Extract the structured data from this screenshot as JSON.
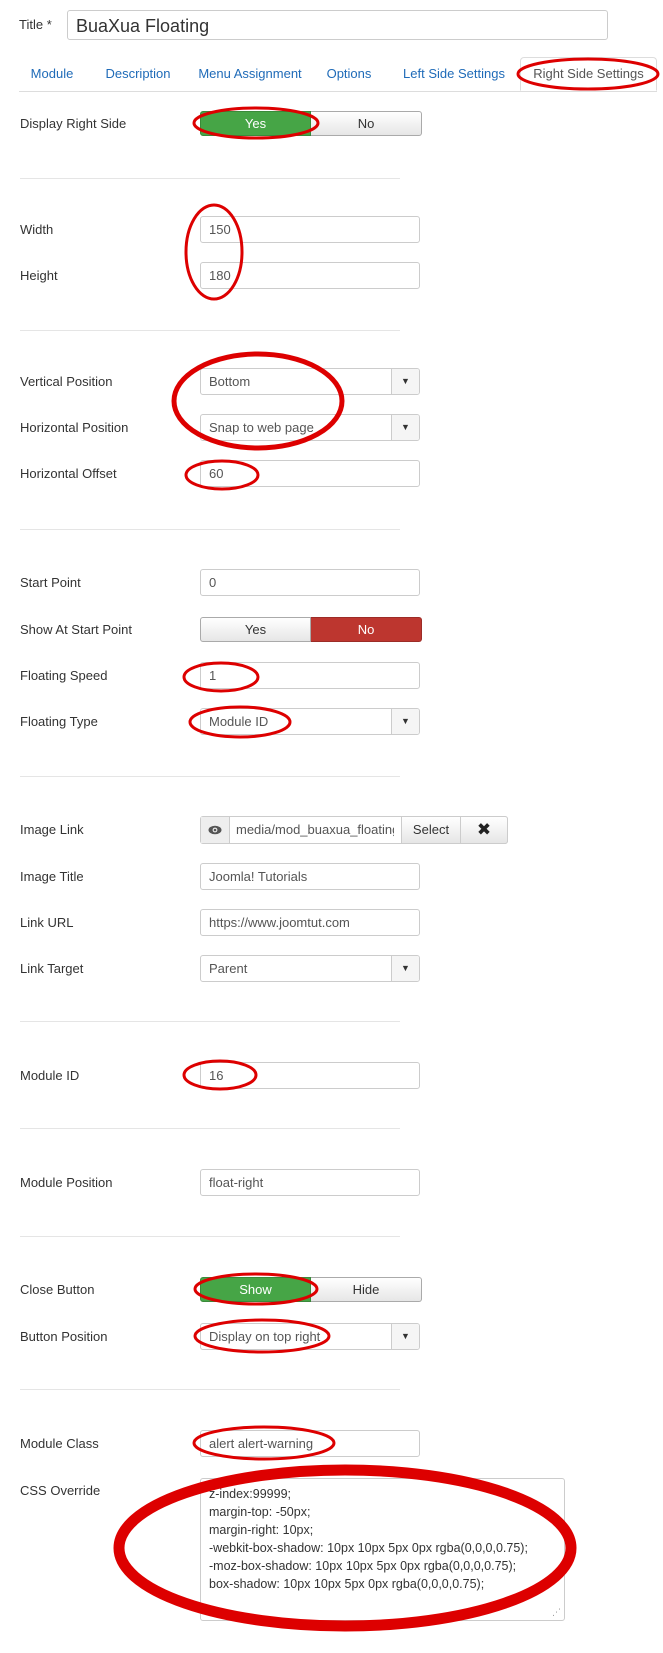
{
  "title": {
    "label": "Title *",
    "value": "BuaXua Floating"
  },
  "tabs": [
    "Module",
    "Description",
    "Menu Assignment",
    "Options",
    "Left Side Settings",
    "Right Side Settings"
  ],
  "display_right_side": {
    "label": "Display Right Side",
    "on": "Yes",
    "off": "No"
  },
  "width": {
    "label": "Width",
    "value": "150"
  },
  "height": {
    "label": "Height",
    "value": "180"
  },
  "vertical_position": {
    "label": "Vertical Position",
    "value": "Bottom"
  },
  "horizontal_position": {
    "label": "Horizontal Position",
    "value": "Snap to web page"
  },
  "horizontal_offset": {
    "label": "Horizontal Offset",
    "value": "60"
  },
  "start_point": {
    "label": "Start Point",
    "value": "0"
  },
  "show_at_start_point": {
    "label": "Show At Start Point",
    "on": "Yes",
    "off": "No"
  },
  "floating_speed": {
    "label": "Floating Speed",
    "value": "1"
  },
  "floating_type": {
    "label": "Floating Type",
    "value": "Module ID"
  },
  "image_link": {
    "label": "Image Link",
    "value": "media/mod_buaxua_floating.",
    "select": "Select",
    "clear": "✖"
  },
  "image_title": {
    "label": "Image Title",
    "value": "Joomla! Tutorials"
  },
  "link_url": {
    "label": "Link URL",
    "value": "https://www.joomtut.com"
  },
  "link_target": {
    "label": "Link Target",
    "value": "Parent"
  },
  "module_id": {
    "label": "Module ID",
    "value": "16"
  },
  "module_position": {
    "label": "Module Position",
    "value": "float-right"
  },
  "close_button": {
    "label": "Close Button",
    "on": "Show",
    "off": "Hide"
  },
  "button_position": {
    "label": "Button Position",
    "value": "Display on top right"
  },
  "module_class": {
    "label": "Module Class",
    "value": "alert alert-warning"
  },
  "css_override": {
    "label": "CSS Override",
    "value": "z-index:99999;\nmargin-top: -50px;\nmargin-right: 10px;\n-webkit-box-shadow: 10px 10px 5px 0px rgba(0,0,0,0.75);\n-moz-box-shadow: 10px 10px 5px 0px rgba(0,0,0,0.75);\nbox-shadow: 10px 10px 5px 0px rgba(0,0,0,0.75);"
  },
  "icons": {
    "eye": "eye-icon",
    "caret": "chevron-down-icon",
    "grip": "resize-grip-icon"
  },
  "colors": {
    "link": "#1f6bb8",
    "green": "#46a546",
    "red": "#bd362f",
    "highlight": "#dd0000"
  }
}
